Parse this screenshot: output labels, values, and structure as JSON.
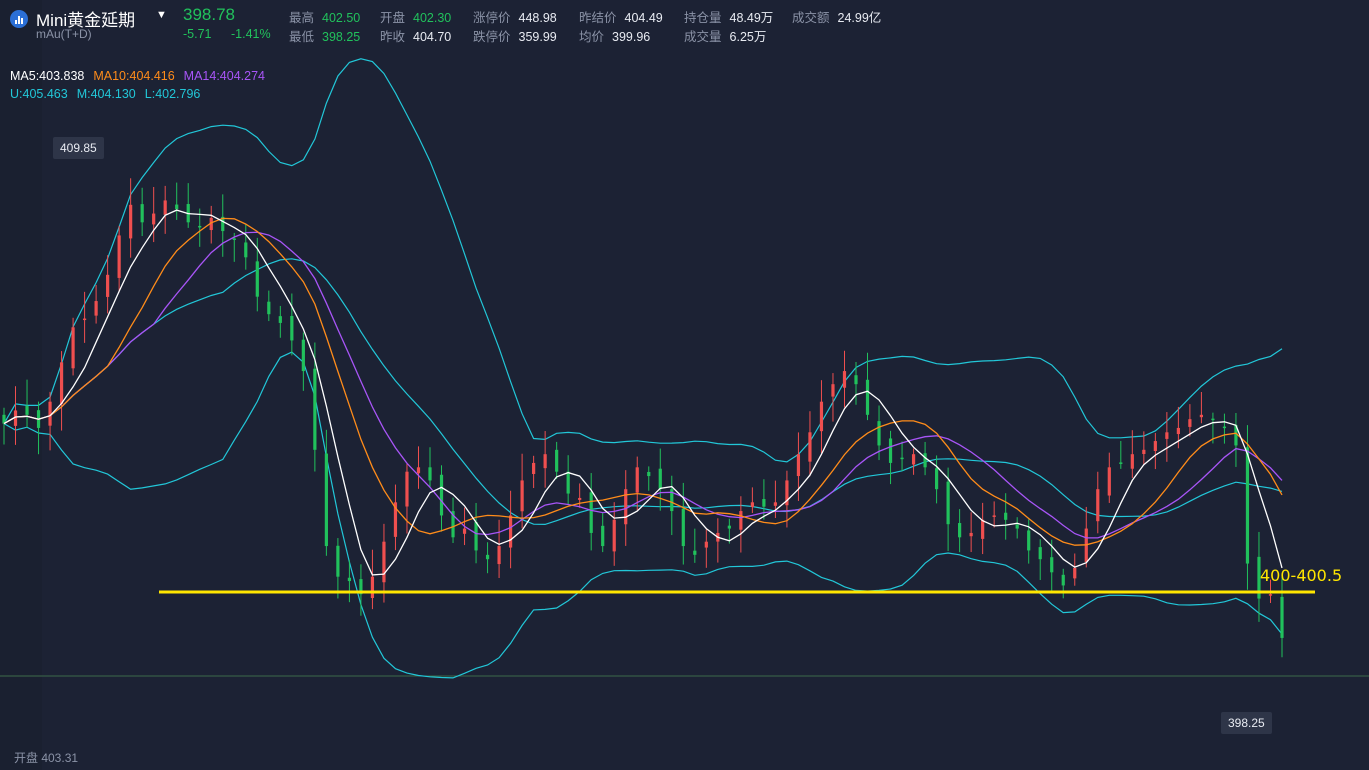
{
  "header": {
    "title": "Mini黄金延期",
    "subtitle": "mAu(T+D)",
    "last_price": "398.78",
    "change": "-5.71",
    "change_pct": "-1.41%",
    "row1": [
      {
        "k": "最高",
        "v": "402.50",
        "green": true
      },
      {
        "k": "开盘",
        "v": "402.30",
        "green": true
      },
      {
        "k": "涨停价",
        "v": "448.98",
        "green": false
      },
      {
        "k": "昨结价",
        "v": "404.49",
        "green": false
      },
      {
        "k": "持仓量",
        "v": "48.49万",
        "green": false
      },
      {
        "k": "成交额",
        "v": "24.99亿",
        "green": false
      }
    ],
    "row2": [
      {
        "k": "最低",
        "v": "398.25",
        "green": true
      },
      {
        "k": "昨收",
        "v": "404.70",
        "green": false
      },
      {
        "k": "跌停价",
        "v": "359.99",
        "green": false
      },
      {
        "k": "均价",
        "v": "399.96",
        "green": false
      },
      {
        "k": "成交量",
        "v": "6.25万",
        "green": false
      }
    ]
  },
  "indicators": {
    "ma5": "MA5:403.838",
    "ma10": "MA10:404.416",
    "ma14": "MA14:404.274",
    "boll_u": "U:405.463",
    "boll_m": "M:404.130",
    "boll_l": "L:402.796"
  },
  "chart_data": {
    "type": "candlestick",
    "high_label": "409.85",
    "low_label": "398.25",
    "annotation": "400-400.5",
    "open_reference": "开盘 403.31",
    "support_level": 400.25,
    "prev_close": 398.78,
    "ylim": [
      397.8,
      411.5
    ],
    "close": [
      404.1,
      404.4,
      404.3,
      404.0,
      404.6,
      405.5,
      406.3,
      406.5,
      406.9,
      407.5,
      408.4,
      409.1,
      408.7,
      408.9,
      409.2,
      409.0,
      408.7,
      408.6,
      408.8,
      408.5,
      408.3,
      407.9,
      407.0,
      406.6,
      406.4,
      406.0,
      405.3,
      403.5,
      401.3,
      400.6,
      400.5,
      400.2,
      400.6,
      401.4,
      402.3,
      403.0,
      403.1,
      402.8,
      402.0,
      401.5,
      401.7,
      401.2,
      401.0,
      401.3,
      402.0,
      402.8,
      403.2,
      403.4,
      403.0,
      402.5,
      402.4,
      401.6,
      401.3,
      401.9,
      402.6,
      403.1,
      402.9,
      402.6,
      402.1,
      401.3,
      401.1,
      401.4,
      401.6,
      401.7,
      402.1,
      402.3,
      402.2,
      402.3,
      402.8,
      403.4,
      403.9,
      404.6,
      405.0,
      405.3,
      405.0,
      404.3,
      403.6,
      403.2,
      403.3,
      403.4,
      403.1,
      402.6,
      401.8,
      401.5,
      401.6,
      401.9,
      402.0,
      401.9,
      401.7,
      401.2,
      401.0,
      400.7,
      400.4,
      400.8,
      401.7,
      402.6,
      403.1,
      403.2,
      403.4,
      403.5,
      403.7,
      403.9,
      404.0,
      404.2,
      404.3,
      404.2,
      404.0,
      403.6,
      400.9,
      400.1,
      400.2,
      399.2
    ]
  }
}
